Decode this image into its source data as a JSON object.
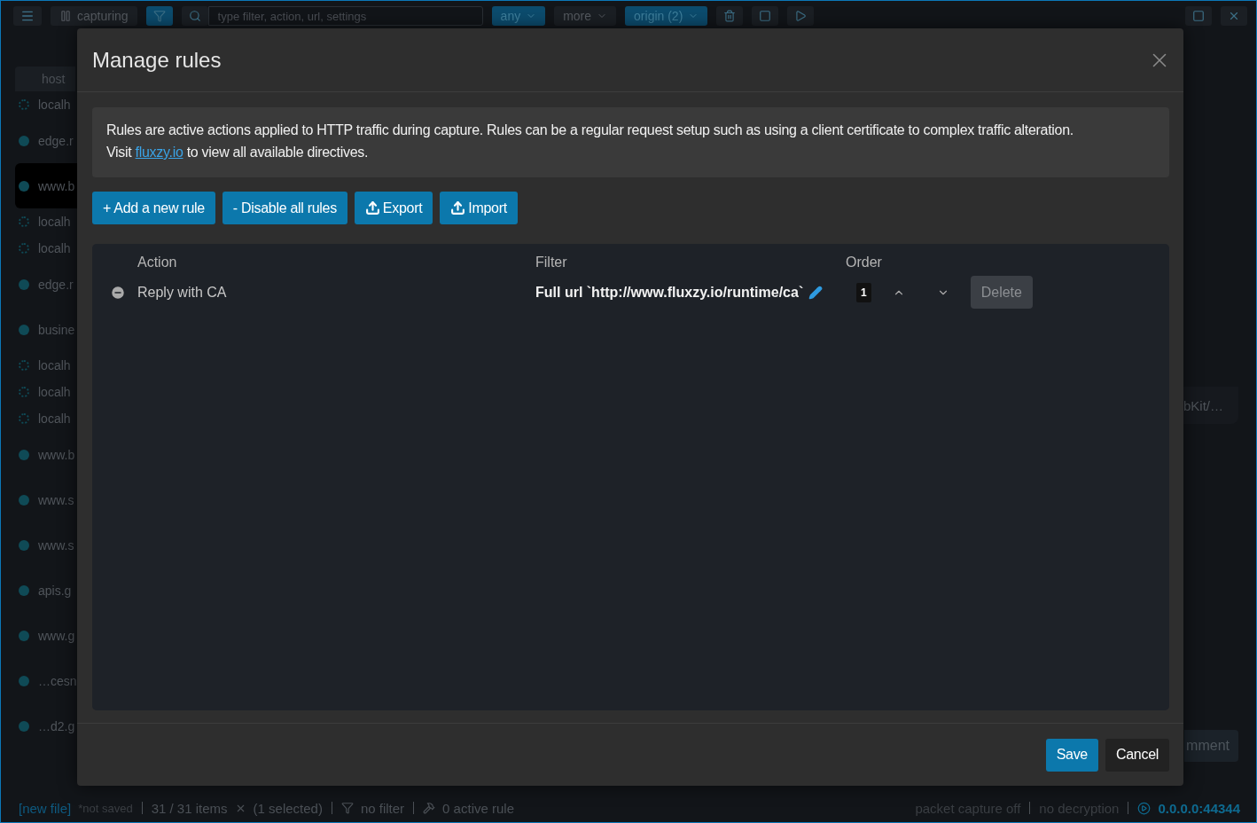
{
  "app": {
    "toolbar": {
      "capture_button": "capturing",
      "search": {
        "placeholder": "type filter, action, url, settings"
      },
      "chips": [
        {
          "label": "any",
          "selected": true
        },
        {
          "label": "more",
          "selected": false
        },
        {
          "label": "origin (2)",
          "selected": true
        }
      ]
    },
    "host_list": {
      "header": "host",
      "rows": [
        {
          "host": "localh",
          "kind": "pending",
          "selected": false
        },
        {
          "host": "edge.r",
          "kind": "done",
          "selected": false
        },
        {
          "host": "www.b",
          "kind": "done",
          "selected": true
        },
        {
          "host": "localh",
          "kind": "pending",
          "selected": false
        },
        {
          "host": "localh",
          "kind": "pending",
          "selected": false
        },
        {
          "host": "edge.r",
          "kind": "done",
          "selected": false
        },
        {
          "host": "busine",
          "kind": "done",
          "selected": false
        },
        {
          "host": "localh",
          "kind": "pending",
          "selected": false
        },
        {
          "host": "localh",
          "kind": "pending",
          "selected": false
        },
        {
          "host": "localh",
          "kind": "pending",
          "selected": false
        },
        {
          "host": "www.b",
          "kind": "done",
          "selected": false
        },
        {
          "host": "www.s",
          "kind": "done",
          "selected": false
        },
        {
          "host": "www.s",
          "kind": "done",
          "selected": false
        },
        {
          "host": "apis.g",
          "kind": "done",
          "selected": false
        },
        {
          "host": "www.g",
          "kind": "done",
          "selected": false
        },
        {
          "host": "…cesn",
          "kind": "done",
          "selected": false
        },
        {
          "host": "…d2.g",
          "kind": "done",
          "selected": false
        }
      ]
    },
    "detail_text": "bKit/…",
    "comment_button": "mment",
    "status_bar": {
      "file": "[new file]",
      "save_state": "*not saved",
      "items": "31 / 31 items",
      "selection": "(1 selected)",
      "filter": "no filter",
      "rules": "0 active rule",
      "capture": "packet capture off",
      "decryption": "no decryption",
      "address": "0.0.0.0:44344"
    }
  },
  "dialog": {
    "title": "Manage rules",
    "intro": "Rules are active actions applied to HTTP traffic during capture. Rules can be a regular request setup such as using a client certificate to complex traffic alteration.",
    "visit": {
      "before": "Visit",
      "link": "fluxzy.io",
      "after": "to view all available directives."
    },
    "actions": [
      {
        "kind": "add",
        "label": "+ Add a new rule"
      },
      {
        "kind": "disable",
        "label": "- Disable all rules"
      },
      {
        "kind": "export",
        "label": "Export"
      },
      {
        "kind": "import",
        "label": "Import"
      }
    ],
    "columns": [
      "Action",
      "Filter",
      "Order"
    ],
    "rules": [
      {
        "action": "Reply with CA",
        "filter": "Full url `http://www.fluxzy.io/runtime/ca`",
        "order": "1",
        "delete": "Delete"
      }
    ],
    "footer": [
      {
        "kind": "primary",
        "label": "Save"
      },
      {
        "kind": "secondary",
        "label": "Cancel"
      }
    ]
  }
}
